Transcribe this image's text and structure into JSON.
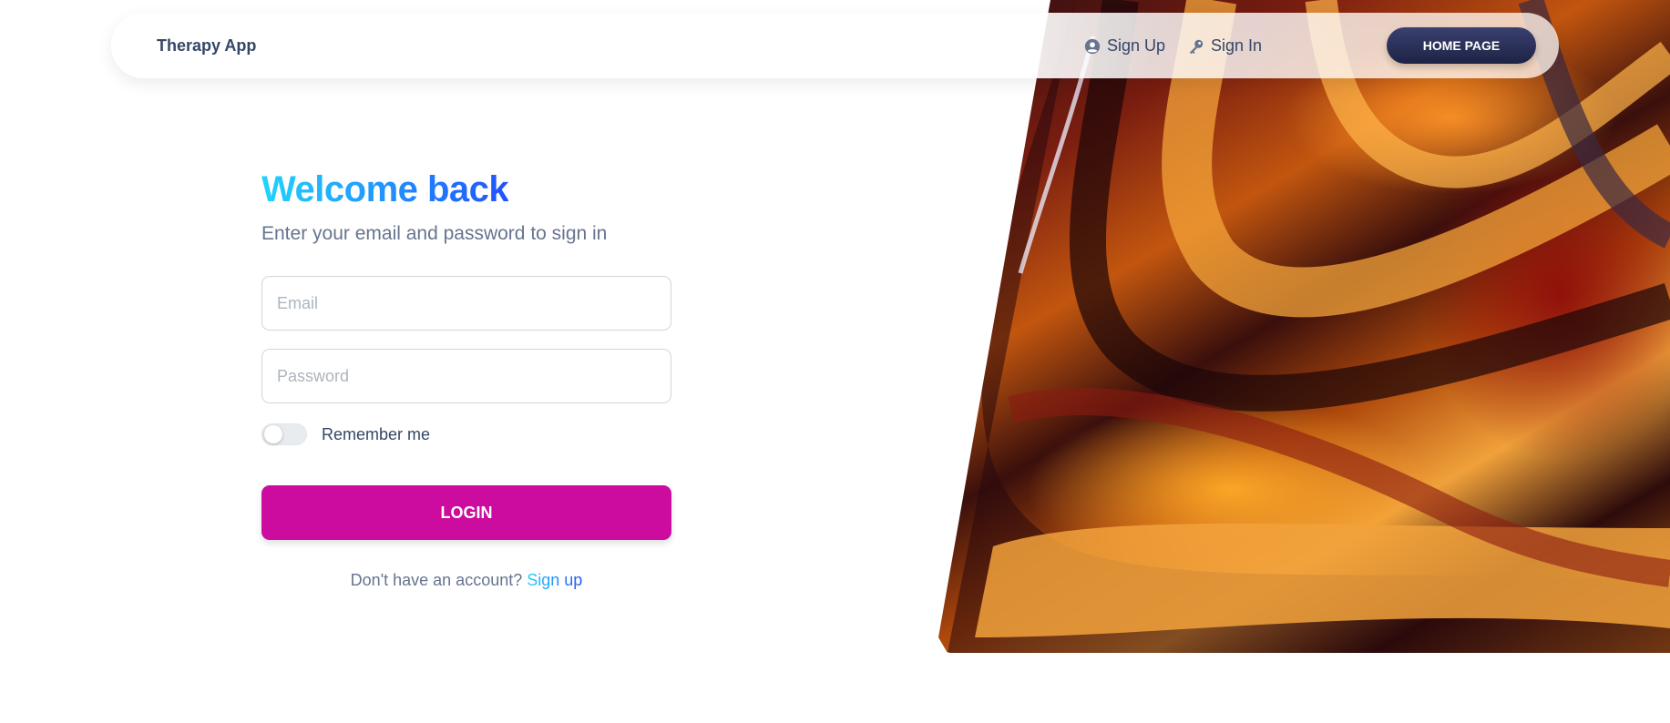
{
  "navbar": {
    "brand": "Therapy App",
    "links": [
      {
        "label": "Sign Up",
        "icon": "user-circle-icon"
      },
      {
        "label": "Sign In",
        "icon": "key-icon"
      }
    ],
    "home_button": "HOME PAGE"
  },
  "form": {
    "title": "Welcome back",
    "subtitle": "Enter your email and password to sign in",
    "email_placeholder": "Email",
    "password_placeholder": "Password",
    "remember_label": "Remember me",
    "remember_checked": false,
    "login_button": "LOGIN",
    "footer_text": "Don't have an account?",
    "footer_link": "Sign up"
  },
  "colors": {
    "primary_button": "#cb0c9f",
    "title_gradient_start": "#21d4fd",
    "title_gradient_end": "#2152ff",
    "dark_button": "#3a416f",
    "text_dark": "#344767",
    "text_muted": "#67748e"
  }
}
